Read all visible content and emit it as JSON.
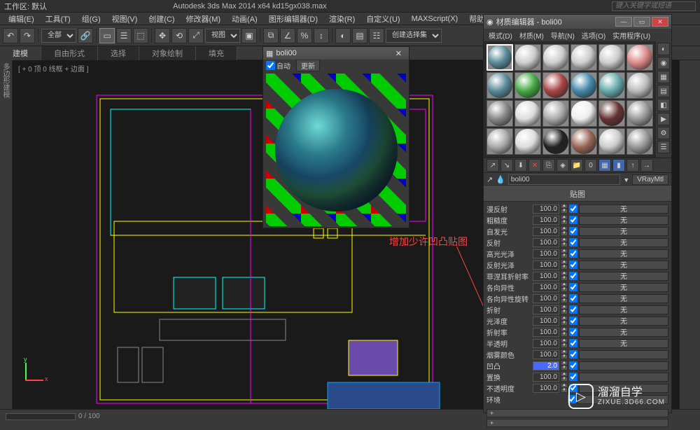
{
  "title_bar": {
    "workspace_label": "工作区: 默认",
    "app_title": "Autodesk 3ds Max  2014 x64    kd15gx038.max",
    "search_placeholder": "键入关键字或短语"
  },
  "menu": [
    "编辑(E)",
    "工具(T)",
    "组(G)",
    "视图(V)",
    "创建(C)",
    "修改器(M)",
    "动画(A)",
    "图形编辑器(D)",
    "渲染(R)",
    "自定义(U)",
    "MAXScript(X)",
    "帮助(H)"
  ],
  "toolbar": {
    "selset_dropdown": "全部",
    "view_dropdown": "视图",
    "create_set": "创建选择集"
  },
  "tabs": [
    "建模",
    "自由形式",
    "选择",
    "对象绘制",
    "填充"
  ],
  "active_tab": 0,
  "left_sidebar_label": "多边形建模",
  "viewport_label": "[ + 0 顶 0 线框 + 边面 ]",
  "status": {
    "frame": "0 / 100",
    "extra": "0"
  },
  "preview_window": {
    "title": "boli00",
    "auto_label": "自动",
    "update_label": "更新"
  },
  "annotation_text": "增加少许凹凸贴图",
  "material_editor": {
    "title": "材质编辑器 - boli00",
    "menu": [
      "模式(D)",
      "材质(M)",
      "导航(N)",
      "选项(O)",
      "实用程序(U)"
    ],
    "name_field": "boli00",
    "type_button": "VRayMtl",
    "rollout_title": "贴图",
    "params": [
      {
        "label": "漫反射",
        "value": "100.0",
        "checked": true,
        "map": "无",
        "hl": false
      },
      {
        "label": "粗糙度",
        "value": "100.0",
        "checked": true,
        "map": "无",
        "hl": false
      },
      {
        "label": "自发光",
        "value": "100.0",
        "checked": true,
        "map": "无",
        "hl": false
      },
      {
        "label": "反射",
        "value": "100.0",
        "checked": true,
        "map": "无",
        "hl": false
      },
      {
        "label": "高光光泽",
        "value": "100.0",
        "checked": true,
        "map": "无",
        "hl": false
      },
      {
        "label": "反射光泽",
        "value": "100.0",
        "checked": true,
        "map": "无",
        "hl": false
      },
      {
        "label": "菲涅耳折射率",
        "value": "100.0",
        "checked": true,
        "map": "无",
        "hl": false
      },
      {
        "label": "各向异性",
        "value": "100.0",
        "checked": true,
        "map": "无",
        "hl": false
      },
      {
        "label": "各向异性旋转",
        "value": "100.0",
        "checked": true,
        "map": "无",
        "hl": false
      },
      {
        "label": "折射",
        "value": "100.0",
        "checked": true,
        "map": "无",
        "hl": false
      },
      {
        "label": "光泽度",
        "value": "100.0",
        "checked": true,
        "map": "无",
        "hl": false
      },
      {
        "label": "折射率",
        "value": "100.0",
        "checked": true,
        "map": "无",
        "hl": false
      },
      {
        "label": "半透明",
        "value": "100.0",
        "checked": true,
        "map": "无",
        "hl": false
      },
      {
        "label": "烟雾颜色",
        "value": "100.0",
        "checked": true,
        "map": "",
        "hl": false
      },
      {
        "label": "凹凸",
        "value": "2.0",
        "checked": true,
        "map": "",
        "hl": true
      },
      {
        "label": "置换",
        "value": "100.0",
        "checked": true,
        "map": "",
        "hl": false
      },
      {
        "label": "不透明度",
        "value": "100.0",
        "checked": true,
        "map": "",
        "hl": false
      },
      {
        "label": "环境",
        "value": "",
        "checked": true,
        "map": "",
        "hl": false
      }
    ]
  },
  "watermark": {
    "brand": "溜溜自学",
    "sub": "ZIXUE.3D66.COM"
  },
  "axis": {
    "x": "x",
    "y": "y"
  }
}
